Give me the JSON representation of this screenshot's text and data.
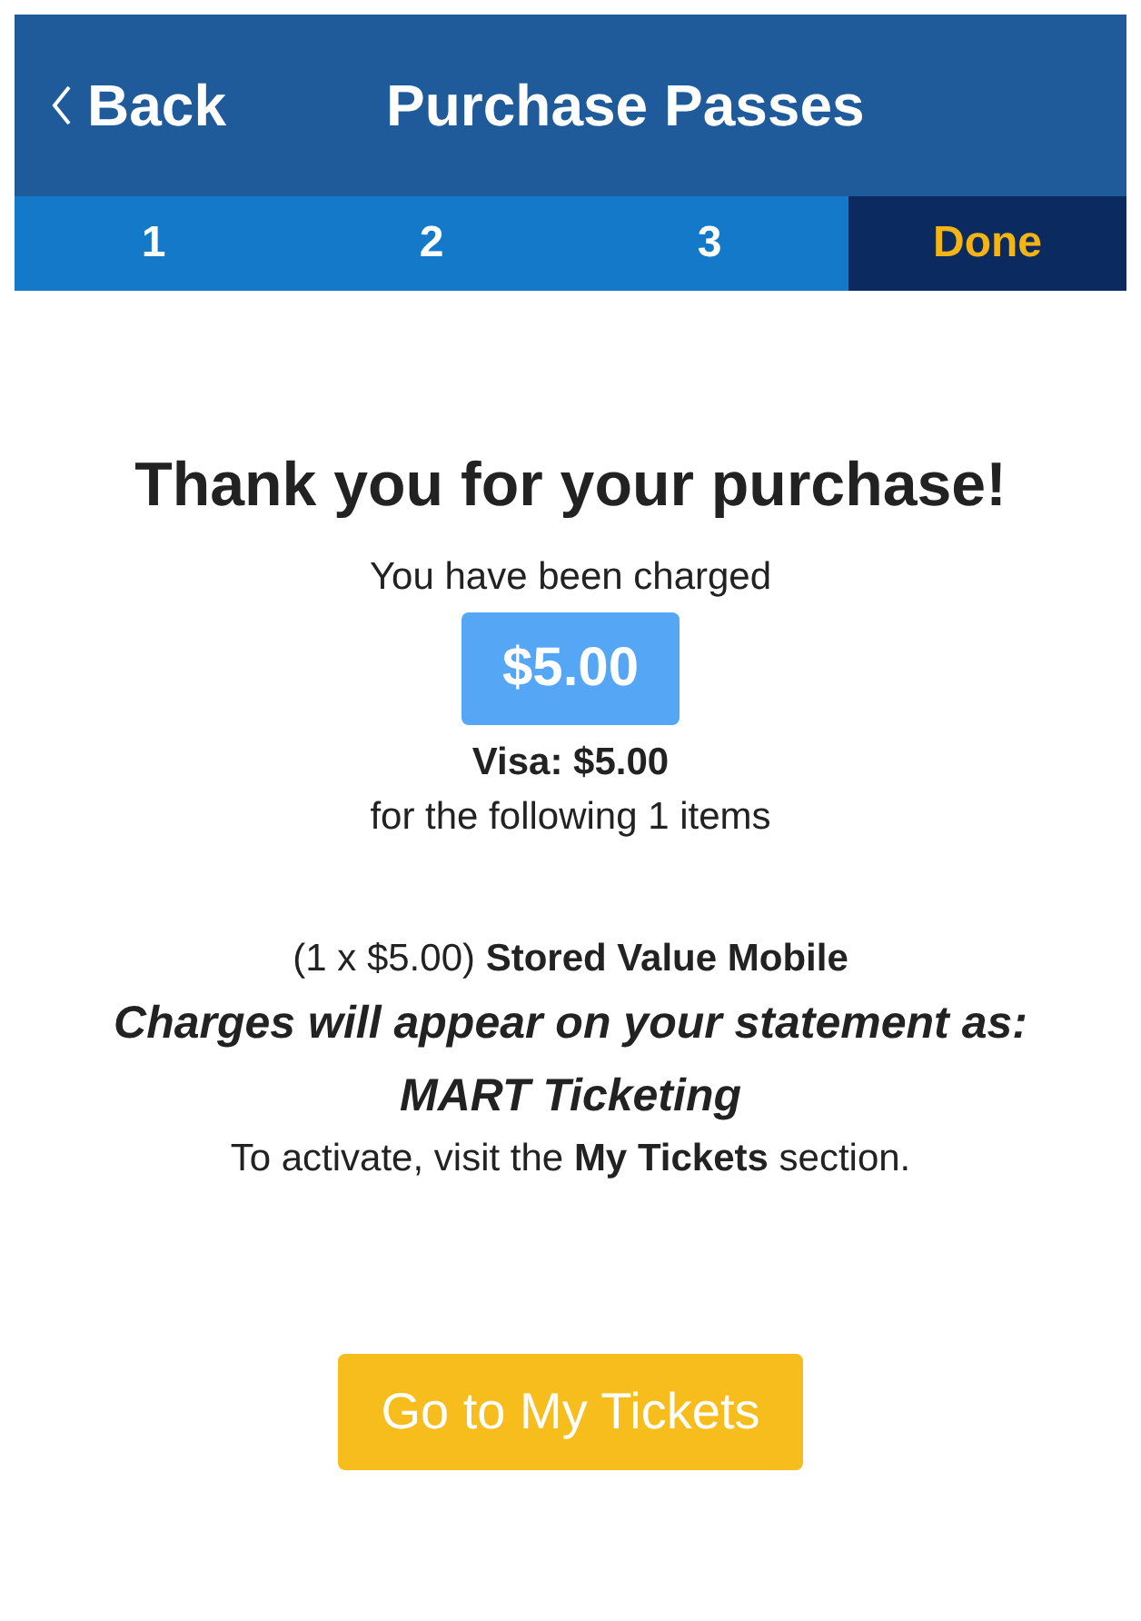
{
  "header": {
    "back": "Back",
    "title": "Purchase Passes"
  },
  "steps": [
    {
      "label": "1",
      "selected": false
    },
    {
      "label": "2",
      "selected": false
    },
    {
      "label": "3",
      "selected": false
    },
    {
      "label": "Done",
      "selected": true
    }
  ],
  "confirmation": {
    "heading": "Thank you for your purchase!",
    "charged_label": "You have been charged",
    "amount": "$5.00",
    "payment": "Visa: $5.00",
    "items_label": "for the following 1 items",
    "items": [
      "(1 x $5.00) **Stored Value Mobile**"
    ],
    "statement_label": "Charges will appear on your statement as:",
    "statement_name": "MART Ticketing",
    "activate_note": "To activate, visit the **My Tickets** section."
  },
  "button": "Go to My Tickets"
}
